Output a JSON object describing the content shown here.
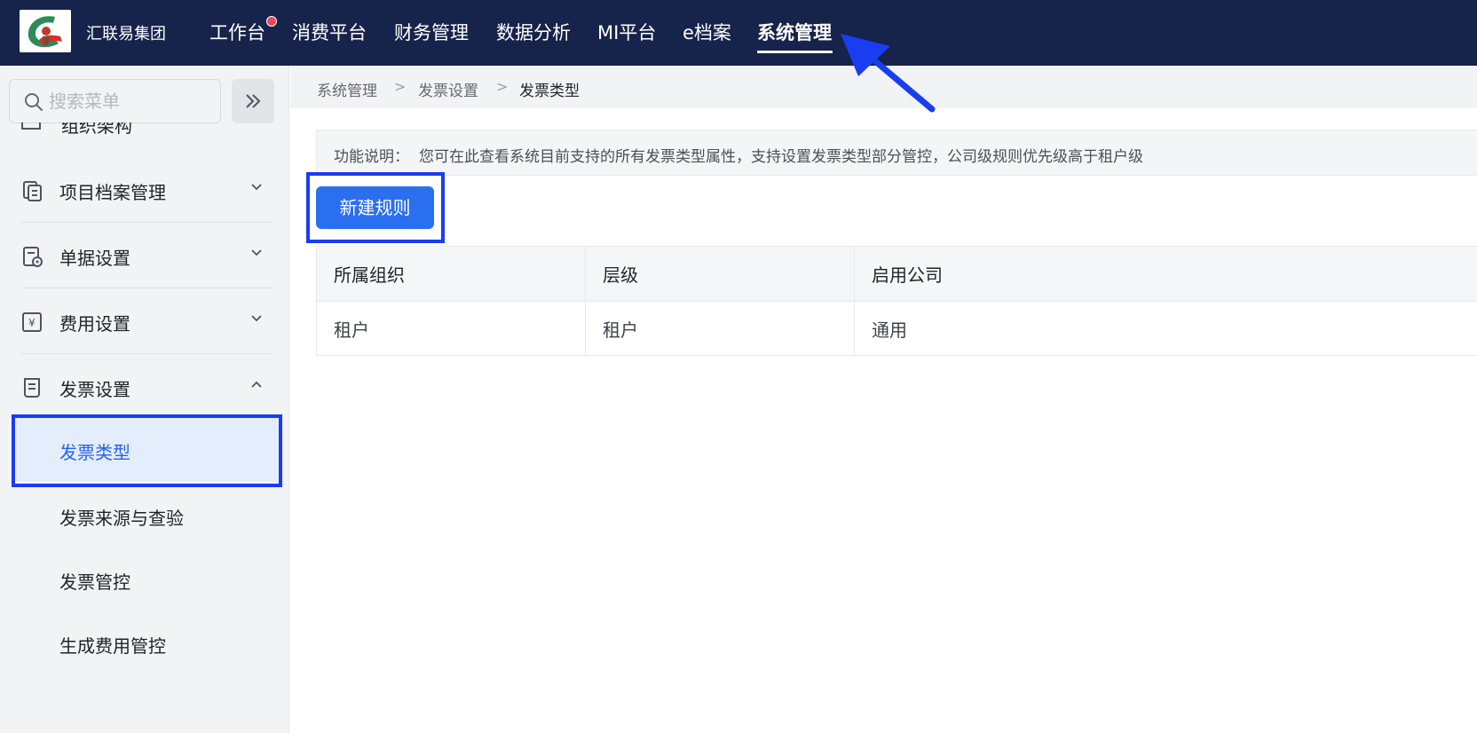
{
  "app": {
    "company_name": "汇联易集团",
    "logo_icon": "company-logo"
  },
  "top_nav": {
    "items": [
      {
        "label": "工作台",
        "active": false,
        "has_notice": true
      },
      {
        "label": "消费平台",
        "active": false
      },
      {
        "label": "财务管理",
        "active": false
      },
      {
        "label": "数据分析",
        "active": false
      },
      {
        "label": "MI平台",
        "active": false
      },
      {
        "label": "e档案",
        "active": false
      },
      {
        "label": "系统管理",
        "active": true
      }
    ],
    "notice_color": "#f0435a"
  },
  "sidebar": {
    "search_placeholder": "搜索菜单",
    "search_icon": "search-icon",
    "collapse_icon": "double-chevron-right-icon",
    "partial_item_label": "组织架构",
    "groups": [
      {
        "label": "项目档案管理",
        "icon": "documents-icon",
        "expanded": false
      },
      {
        "label": "单据设置",
        "icon": "form-settings-icon",
        "expanded": false
      },
      {
        "label": "费用设置",
        "icon": "yen-icon",
        "expanded": false
      },
      {
        "label": "发票设置",
        "icon": "invoice-icon",
        "expanded": true
      }
    ],
    "sub_items": [
      {
        "label": "发票类型",
        "active": true
      },
      {
        "label": "发票来源与查验",
        "active": false
      },
      {
        "label": "发票管控",
        "active": false
      },
      {
        "label": "生成费用管控",
        "active": false
      }
    ]
  },
  "breadcrumb": [
    "系统管理",
    "发票设置",
    "发票类型"
  ],
  "breadcrumb_separator": ">",
  "info": {
    "label": "功能说明：",
    "text": "您可在此查看系统目前支持的所有发票类型属性，支持设置发票类型部分管控，公司级规则优先级高于租户级"
  },
  "new_rule_button": "新建规则",
  "table": {
    "headers": [
      "所属组织",
      "层级",
      "启用公司"
    ],
    "rows": [
      [
        "租户",
        "租户",
        "通用"
      ]
    ]
  },
  "colors": {
    "topbar": "#16234a",
    "primary": "#2a6ff0",
    "active_text": "#2563eb",
    "annotation": "#1a3df0"
  }
}
